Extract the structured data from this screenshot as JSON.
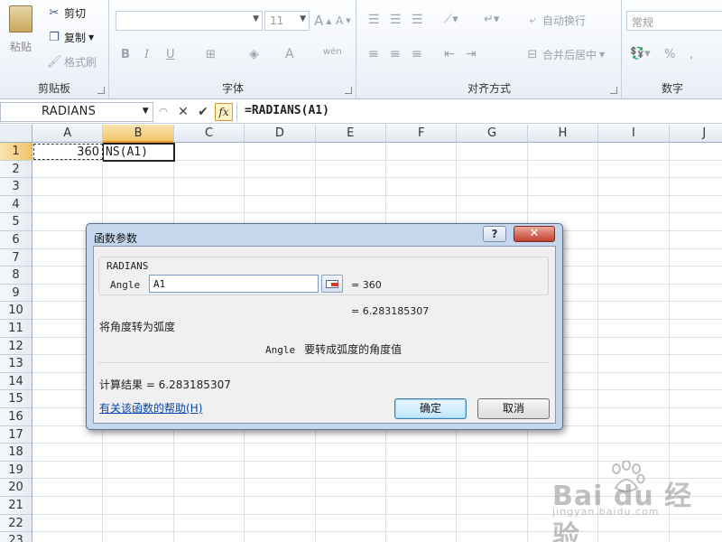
{
  "ribbon": {
    "clipboard": {
      "paste_label": "粘贴",
      "cut_label": "剪切",
      "copy_label": "复制",
      "format_painter_label": "格式刷",
      "group_label": "剪贴板"
    },
    "font": {
      "font_name": "",
      "font_size": "11",
      "group_label": "字体"
    },
    "alignment": {
      "wrap_label": "自动换行",
      "merge_label": "合并后居中",
      "group_label": "对齐方式"
    },
    "number": {
      "format_value": "常规",
      "percent_label": "%",
      "group_label": "数字"
    }
  },
  "formula_bar": {
    "name_box": "RADIANS",
    "formula": "=RADIANS(A1)",
    "fx_label": "fx"
  },
  "sheet": {
    "columns": [
      "A",
      "B",
      "C",
      "D",
      "E",
      "F",
      "G",
      "H",
      "I",
      "J"
    ],
    "rows": [
      "1",
      "2",
      "3",
      "4",
      "5",
      "6",
      "7",
      "8",
      "9",
      "10",
      "11",
      "12",
      "13",
      "14",
      "15",
      "16",
      "17",
      "18",
      "19",
      "20",
      "21",
      "22",
      "23"
    ],
    "cell_a1": "360",
    "cell_b1": "NS(A1)",
    "selected_column": "B",
    "selected_row": "1"
  },
  "dialog": {
    "title": "函数参数",
    "help_button": "?",
    "close_button": "✕",
    "function_name": "RADIANS",
    "arg_label": "Angle",
    "arg_value": "A1",
    "arg_result": "=  360",
    "func_result_line": "=  6.283185307",
    "description": "将角度转为弧度",
    "arg_name": "Angle",
    "arg_description": "要转成弧度的角度值",
    "calc_result": "计算结果 =  6.283185307",
    "help_link": "有关该函数的帮助(H)",
    "ok_label": "确定",
    "cancel_label": "取消"
  },
  "watermark": {
    "brand": "Bai du 经验",
    "url": "jingyan.baidu.com"
  },
  "colors": {
    "selection_header": "#f1c46a",
    "dialog_frame": "#c5d7ec",
    "close_button": "#c3402e"
  }
}
